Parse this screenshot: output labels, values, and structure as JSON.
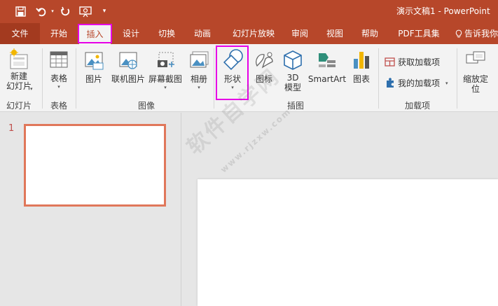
{
  "app": {
    "document_title": "演示文稿1 - PowerPoint"
  },
  "tabs": [
    {
      "label": "文件"
    },
    {
      "label": "开始"
    },
    {
      "label": "插入"
    },
    {
      "label": "设计"
    },
    {
      "label": "切换"
    },
    {
      "label": "动画"
    },
    {
      "label": "幻灯片放映"
    },
    {
      "label": "审阅"
    },
    {
      "label": "视图"
    },
    {
      "label": "帮助"
    },
    {
      "label": "PDF工具集"
    },
    {
      "label": "告诉我你"
    }
  ],
  "ribbon": {
    "groups": {
      "slides": "幻灯片",
      "tables": "表格",
      "images": "图像",
      "illustrations": "插图",
      "addins": "加载项"
    },
    "buttons": {
      "new_slide_line1": "新建",
      "new_slide_line2": "幻灯片",
      "table": "表格",
      "picture": "图片",
      "online_picture": "联机图片",
      "screenshot": "屏幕截图",
      "album": "相册",
      "shapes": "形状",
      "icons": "图标",
      "model_3d_line1": "3D",
      "model_3d_line2": "模型",
      "smartart": "SmartArt",
      "chart": "图表",
      "get_addins": "获取加载项",
      "my_addins": "我的加载项",
      "zoom_line1": "缩放定",
      "zoom_line2": "位"
    }
  },
  "slides_panel": {
    "slide_number": "1"
  },
  "watermark": {
    "text": "软件自学网",
    "url": "www.rjzxw.com"
  },
  "colors": {
    "accent": "#b7472a",
    "highlight": "#e600e6",
    "thumb_border": "#e0775a"
  }
}
